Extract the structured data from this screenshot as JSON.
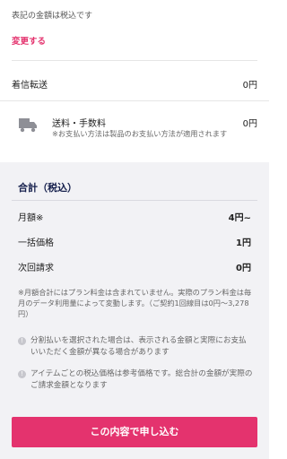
{
  "pricing_note": "表記の金額は税込です",
  "change_link": "変更する",
  "incoming_transfer": {
    "label": "着信転送",
    "value": "0円"
  },
  "shipping": {
    "title": "送料・手数料",
    "price": "0円",
    "note": "※お支払い方法は製品のお支払い方法が適用されます"
  },
  "summary": {
    "title": "合計（税込）",
    "rows": [
      {
        "label": "月額※",
        "value": "4円~"
      },
      {
        "label": "一括価格",
        "value": "1円"
      },
      {
        "label": "次回請求",
        "value": "0円"
      }
    ],
    "note": "※月額合計にはプラン料金は含まれていません。実際のプラン料金は毎月のデータ利用量によって変動します。（ご契約1回線目は0円〜3,278円）"
  },
  "info_notes": [
    {
      "icon": "info-icon",
      "text": "分割払いを選択された場合は、表示される金額と実際にお支払いいただく金額が異なる場合があります"
    },
    {
      "icon": "info-icon",
      "text": "アイテムごとの税込価格は参考価格です。総合計の金額が実際のご請求金額となります"
    }
  ],
  "cta": {
    "label": "この内容で申し込む"
  },
  "colors": {
    "accent": "#e4336e",
    "summary_bg": "#f2f2f5",
    "title_navy": "#16204d"
  }
}
